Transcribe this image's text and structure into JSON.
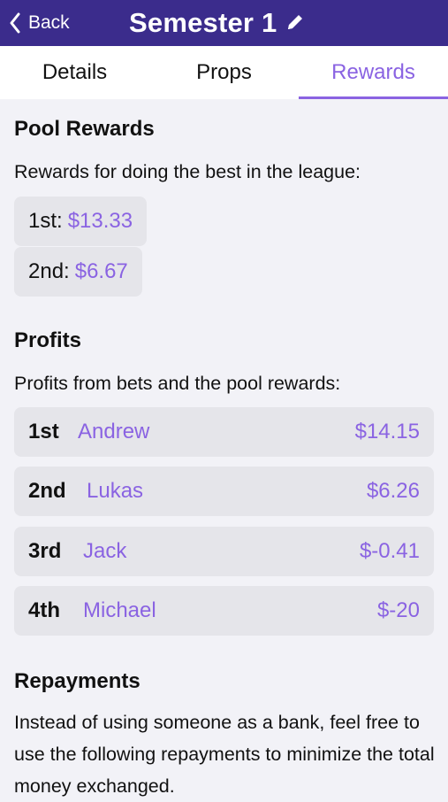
{
  "nav": {
    "back_label": "Back",
    "title": "Semester 1"
  },
  "tabs": [
    {
      "label": "Details"
    },
    {
      "label": "Props"
    },
    {
      "label": "Rewards"
    }
  ],
  "pool": {
    "heading": "Pool Rewards",
    "description": "Rewards for doing the best in the league:",
    "items": [
      {
        "place": "1st:",
        "amount": "$13.33"
      },
      {
        "place": "2nd:",
        "amount": "$6.67"
      }
    ]
  },
  "profits": {
    "heading": "Profits",
    "description": "Profits from bets and the pool rewards:",
    "rows": [
      {
        "rank": "1st",
        "name": "Andrew",
        "amount": "$14.15"
      },
      {
        "rank": "2nd",
        "name": "Lukas",
        "amount": "$6.26"
      },
      {
        "rank": "3rd",
        "name": "Jack",
        "amount": "$-0.41"
      },
      {
        "rank": "4th",
        "name": "Michael",
        "amount": "$-20"
      }
    ]
  },
  "repayments": {
    "heading": "Repayments",
    "description": "Instead of using someone as a bank, feel free to use the following repayments to minimize the total money exchanged."
  },
  "colors": {
    "nav_bg": "#3b2c8c",
    "accent": "#8a63e2",
    "chip_bg": "#e5e5ea",
    "page_bg": "#f2f2f7"
  },
  "icons": {
    "back": "chevron-left-icon",
    "edit": "pencil-icon"
  }
}
